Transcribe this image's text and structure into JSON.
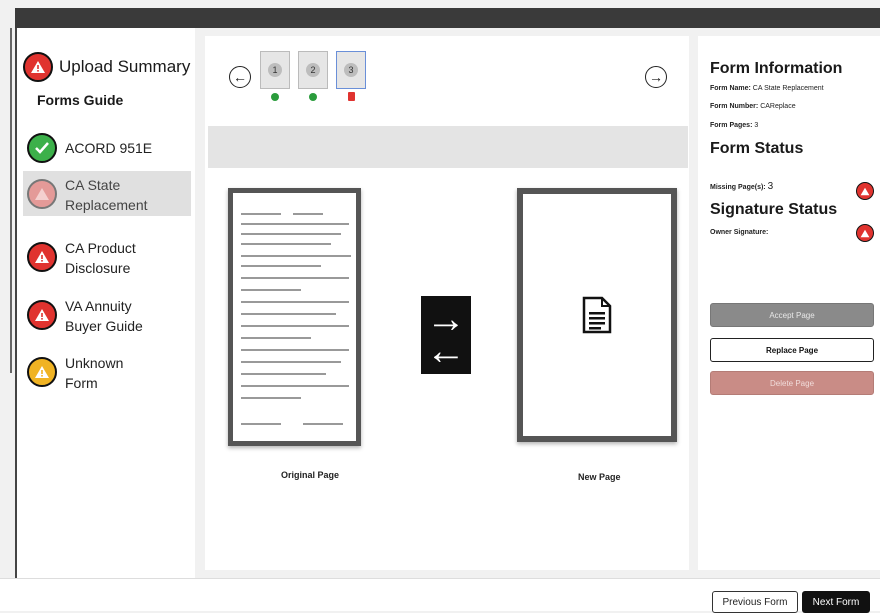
{
  "sidebar": {
    "summary_title": "Upload Summary",
    "guide_title": "Forms Guide",
    "forms": [
      {
        "label": "ACORD 951E",
        "status": "complete"
      },
      {
        "label": "CA State\nReplacement",
        "status": "error",
        "selected": true
      },
      {
        "label": "CA Product\nDisclosure",
        "status": "error"
      },
      {
        "label": "VA Annuity\nBuyer Guide",
        "status": "error"
      },
      {
        "label": "Unknown\nForm",
        "status": "warning"
      }
    ]
  },
  "thumbnails": [
    {
      "num": "1",
      "status": "ok"
    },
    {
      "num": "2",
      "status": "ok"
    },
    {
      "num": "3",
      "status": "missing"
    }
  ],
  "viewer": {
    "original_caption": "Original Page",
    "new_caption": "New Page"
  },
  "info": {
    "form_info_title": "Form Information",
    "form_name_label": "Form Name:",
    "form_name_value": "CA State Replacement",
    "form_number_label": "Form Number:",
    "form_number_value": "CAReplace",
    "form_pages_label": "Form Pages:",
    "form_pages_value": "3",
    "form_status_title": "Form Status",
    "missing_label": "Missing Page(s):",
    "missing_value": "3",
    "sig_status_title": "Signature Status",
    "owner_sig_label": "Owner Signature:"
  },
  "actions": {
    "accept": "Accept Page",
    "replace": "Replace Page",
    "delete": "Delete Page"
  },
  "footer": {
    "prev": "Previous Form",
    "next": "Next Form"
  },
  "colors": {
    "error": "#e0332f",
    "complete": "#3cb04a",
    "warning": "#f0b323"
  }
}
